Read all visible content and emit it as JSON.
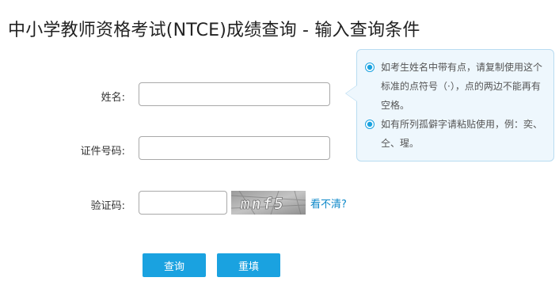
{
  "page": {
    "title": "中小学教师资格考试(NTCE)成绩查询 - 输入查询条件"
  },
  "form": {
    "name_label": "姓名:",
    "name_value": "",
    "id_label": "证件号码:",
    "id_value": "",
    "captcha_label": "验证码:",
    "captcha_value": "",
    "captcha_image_text": "mnf5",
    "captcha_refresh_link": "看不清?"
  },
  "buttons": {
    "search": "查询",
    "reset": "重填"
  },
  "tooltip": {
    "tips": [
      "如考生姓名中带有点，请复制使用这个标准的点符号（·），点的两边不能再有空格。",
      "如有所列孤僻字请粘贴使用，例：奕、仝、瑆。"
    ]
  },
  "colors": {
    "accent": "#1aa2e0",
    "link": "#0d88c9",
    "tooltip_bg": "#eef7fd",
    "tooltip_border": "#b9dcf1"
  }
}
